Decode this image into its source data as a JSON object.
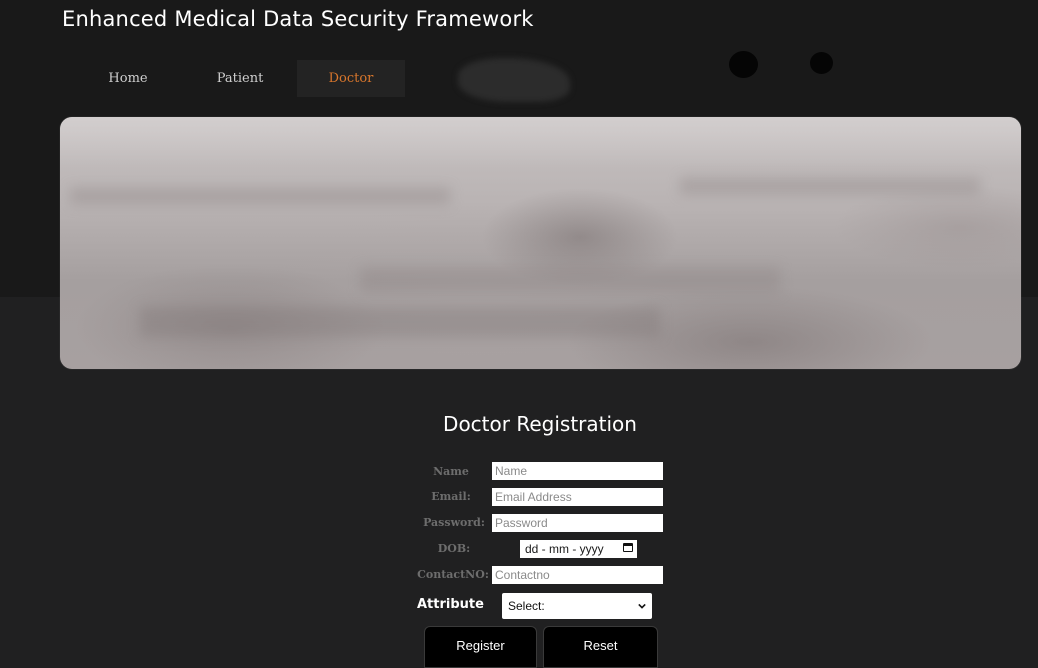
{
  "app": {
    "title": "Enhanced Medical Data Security Framework"
  },
  "nav": {
    "items": [
      {
        "label": "Home",
        "active": false
      },
      {
        "label": "Patient",
        "active": false
      },
      {
        "label": "Doctor",
        "active": true
      }
    ],
    "active_color": "#d8762c"
  },
  "hero": {
    "description": "banner image"
  },
  "form": {
    "title": "Doctor Registration",
    "fields": {
      "name": {
        "label": "Name",
        "placeholder": "Name",
        "value": ""
      },
      "email": {
        "label": "Email:",
        "placeholder": "Email Address",
        "value": ""
      },
      "password": {
        "label": "Password:",
        "placeholder": "Password",
        "value": ""
      },
      "dob": {
        "label": "DOB:",
        "display": "dd - mm - yyyy",
        "icon": "calendar-icon"
      },
      "contact": {
        "label": "ContactNO:",
        "placeholder": "Contactno",
        "value": ""
      }
    },
    "attribute": {
      "label": "Attribute",
      "selected": "Select:",
      "icon": "chevron-down-icon"
    },
    "buttons": {
      "register": "Register",
      "reset": "Reset"
    }
  }
}
